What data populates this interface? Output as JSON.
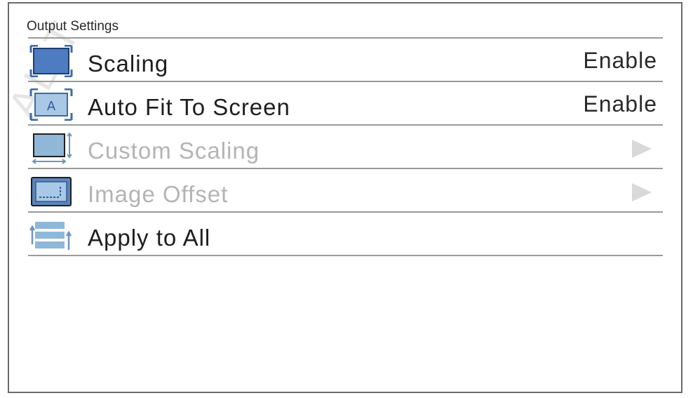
{
  "watermark": "ALIT",
  "panel": {
    "title": "Output Settings"
  },
  "menu": {
    "items": [
      {
        "label": "Scaling",
        "value": "Enable",
        "icon": "scaling-icon",
        "enabled": true
      },
      {
        "label": "Auto Fit To Screen",
        "value": "Enable",
        "icon": "auto-fit-icon",
        "enabled": true
      },
      {
        "label": "Custom Scaling",
        "icon": "custom-scaling-icon",
        "enabled": false,
        "submenu": true
      },
      {
        "label": "Image Offset",
        "icon": "image-offset-icon",
        "enabled": false,
        "submenu": true
      },
      {
        "label": "Apply to All",
        "icon": "apply-all-icon",
        "enabled": true
      }
    ]
  },
  "colors": {
    "icon_blue": "#4d7cc1",
    "icon_light_blue": "#8fb7d8",
    "divider": "#9a9a9a",
    "disabled_text": "#b4b4b4"
  }
}
